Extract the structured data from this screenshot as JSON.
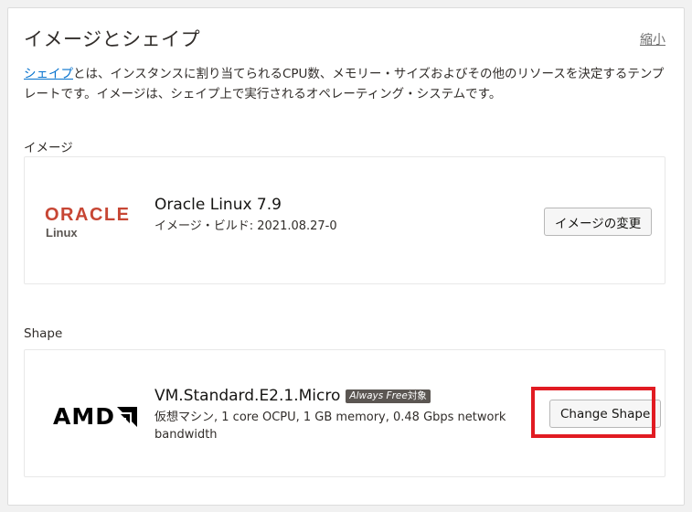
{
  "header": {
    "title": "イメージとシェイプ",
    "collapse_label": "縮小"
  },
  "description": {
    "link_text": "シェイプ",
    "text": "とは、インスタンスに割り当てられるCPU数、メモリー・サイズおよびその他のリソースを決定するテンプレートです。イメージは、シェイプ上で実行されるオペレーティング・システムです。"
  },
  "image_section": {
    "label": "イメージ",
    "logo": {
      "word": "ORACLE",
      "sub": "Linux"
    },
    "name": "Oracle Linux 7.9",
    "build": "イメージ・ビルド: 2021.08.27-0",
    "change_button": "イメージの変更"
  },
  "shape_section": {
    "label": "Shape",
    "logo": {
      "word": "AMD"
    },
    "name": "VM.Standard.E2.1.Micro",
    "badge_italic": "Always Free",
    "badge_suffix": "対象",
    "details": "仮想マシン, 1 core OCPU, 1 GB memory, 0.48 Gbps network bandwidth",
    "change_button": "Change Shape"
  },
  "colors": {
    "link": "#0572ce",
    "oracle_red": "#c74634",
    "highlight": "#e11b22"
  }
}
